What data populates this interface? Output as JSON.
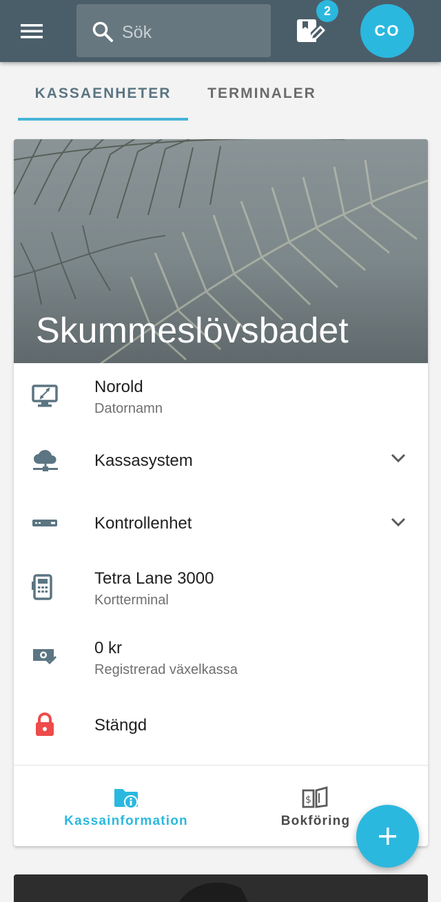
{
  "header": {
    "search_placeholder": "Sök",
    "notifications_count": "2",
    "avatar_initials": "CO"
  },
  "tabs": [
    {
      "label": "KASSAENHETER",
      "active": true
    },
    {
      "label": "TERMINALER",
      "active": false
    }
  ],
  "card": {
    "title": "Skummeslövsbadet",
    "rows": [
      {
        "icon": "remote-desktop-icon",
        "primary": "Norold",
        "secondary": "Datornamn"
      },
      {
        "icon": "cloud-network-icon",
        "primary": "Kassasystem",
        "expandable": true
      },
      {
        "icon": "control-unit-icon",
        "primary": "Kontrollenhet",
        "expandable": true
      },
      {
        "icon": "card-terminal-icon",
        "primary": "Tetra Lane 3000",
        "secondary": "Kortterminal"
      },
      {
        "icon": "cash-check-icon",
        "primary": "0 kr",
        "secondary": "Registrerad växelkassa"
      },
      {
        "icon": "lock-icon",
        "primary": "Stängd"
      }
    ],
    "bottom_nav": [
      {
        "icon": "folder-info-icon",
        "label": "Kassainformation",
        "active": true
      },
      {
        "icon": "book-dollar-icon",
        "label": "Bokföring",
        "active": false
      }
    ]
  },
  "colors": {
    "appbar": "#4a5e6a",
    "accent": "#2bb8de",
    "icon_grey": "#5b7582",
    "lock_red": "#ee4b4b"
  }
}
